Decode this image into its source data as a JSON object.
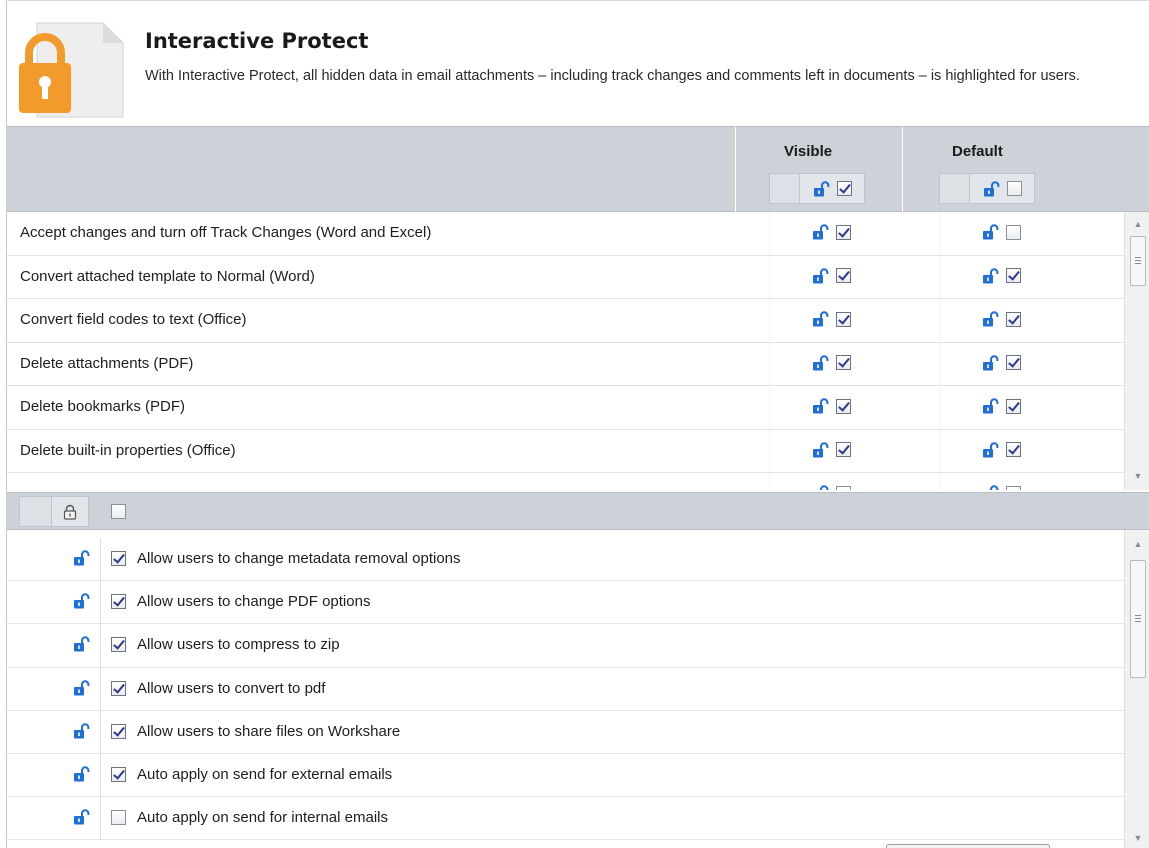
{
  "header": {
    "title": "Interactive Protect",
    "description": "With Interactive Protect, all hidden data in email attachments – including track changes and comments left in documents – is highlighted for users.",
    "icon": "padlock-document-icon",
    "accent_color": "#f39a2c"
  },
  "top_table": {
    "columns": [
      {
        "label": "Visible",
        "header_checked": true
      },
      {
        "label": "Default",
        "header_checked": false
      }
    ],
    "rows": [
      {
        "label": "Accept changes and turn off Track Changes (Word and Excel)",
        "visible": true,
        "default": false
      },
      {
        "label": "Convert attached template to Normal (Word)",
        "visible": true,
        "default": true
      },
      {
        "label": "Convert field codes to text (Office)",
        "visible": true,
        "default": true
      },
      {
        "label": "Delete attachments (PDF)",
        "visible": true,
        "default": true
      },
      {
        "label": "Delete bookmarks (PDF)",
        "visible": true,
        "default": true
      },
      {
        "label": "Delete built-in properties (Office)",
        "visible": true,
        "default": true
      },
      {
        "label": "",
        "visible": false,
        "default": false
      }
    ]
  },
  "bottom_table": {
    "header_checked": false,
    "rows": [
      {
        "label": "Allow users to change metadata removal options",
        "checked": true
      },
      {
        "label": "Allow users to change PDF options",
        "checked": true
      },
      {
        "label": "Allow users to compress to zip",
        "checked": true
      },
      {
        "label": "Allow users to convert to pdf",
        "checked": true
      },
      {
        "label": "Allow users to share files on Workshare",
        "checked": true
      },
      {
        "label": "Auto apply on send for external emails",
        "checked": true
      },
      {
        "label": "Auto apply on send for internal emails",
        "checked": false
      }
    ]
  },
  "colors": {
    "header_bg": "#cdd2d9",
    "lock_blue": "#1f6fd6",
    "check_mark": "#2b3a8a"
  }
}
